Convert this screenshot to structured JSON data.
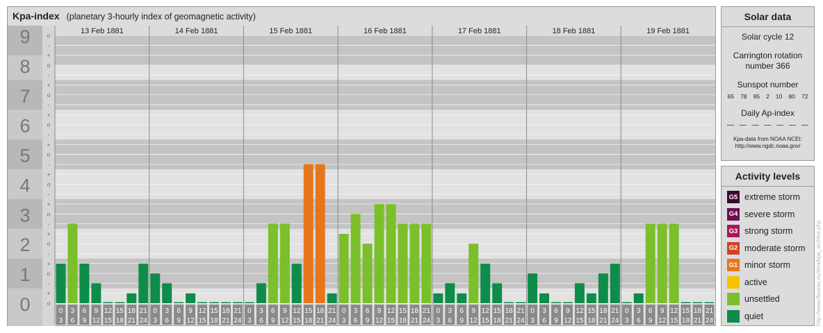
{
  "header": {
    "title": "Kpa-index",
    "subtitle": "(planetary 3-hourly index of geomagnetic activity)"
  },
  "chart_data": {
    "type": "bar",
    "days": [
      "13 Feb 1881",
      "14 Feb 1881",
      "15 Feb 1881",
      "16 Feb 1881",
      "17 Feb 1881",
      "18 Feb 1881",
      "19 Feb 1881"
    ],
    "interval_labels": [
      [
        "0",
        "3"
      ],
      [
        "3",
        "6"
      ],
      [
        "6",
        "9"
      ],
      [
        "9",
        "12"
      ],
      [
        "12",
        "15"
      ],
      [
        "15",
        "18"
      ],
      [
        "18",
        "21"
      ],
      [
        "21",
        "24"
      ]
    ],
    "y_ticks": [
      "0",
      "1",
      "2",
      "3",
      "4",
      "5",
      "6",
      "7",
      "8",
      "9"
    ],
    "sub_ticks": [
      "-",
      "o",
      "+"
    ],
    "ylim": [
      0,
      9.33
    ],
    "values": [
      [
        1.33,
        2.67,
        1.33,
        0.67,
        0,
        0,
        0.33,
        1.33
      ],
      [
        1.0,
        0.67,
        0,
        0.33,
        0,
        0,
        0,
        0
      ],
      [
        0,
        0.67,
        2.67,
        2.67,
        1.33,
        4.67,
        4.67,
        0.33
      ],
      [
        2.33,
        3.0,
        2.0,
        3.33,
        3.33,
        2.67,
        2.67,
        2.67
      ],
      [
        0.33,
        0.67,
        0.33,
        2.0,
        1.33,
        0.67,
        0,
        0
      ],
      [
        1.0,
        0.33,
        0,
        0,
        0.67,
        0.33,
        1.0,
        1.33
      ],
      [
        0,
        0.33,
        2.67,
        2.67,
        2.67,
        0,
        0,
        0
      ]
    ],
    "level_colors": {
      "quiet": "#0e8c4a",
      "unsettled": "#7bbf2a",
      "active": "#f6c200",
      "G1": "#e5771a",
      "G2": "#d34223",
      "G3": "#a8175a",
      "G4": "#6b0f4e",
      "G5": "#3d0730"
    },
    "grid": true
  },
  "solar": {
    "title": "Solar data",
    "cycle": "Solar cycle 12",
    "rotation_line1": "Carrington rotation",
    "rotation_line2": "number 366",
    "sunspot_label": "Sunspot number",
    "sunspots": [
      "65",
      "78",
      "95",
      "2",
      "10",
      "80",
      "72"
    ],
    "ap_label": "Daily Ap-index",
    "ap_values": [
      "—",
      "—",
      "—",
      "—",
      "—",
      "—",
      "—"
    ],
    "credit_line1": "Kpa-data from NOAA NCEI:",
    "credit_line2": "http://www.ngdc.noaa.gov/"
  },
  "activity": {
    "title": "Activity levels",
    "levels": [
      {
        "badge": "G5",
        "label": "extreme storm",
        "color": "#3d0730"
      },
      {
        "badge": "G4",
        "label": "severe storm",
        "color": "#6b0f4e"
      },
      {
        "badge": "G3",
        "label": "strong storm",
        "color": "#a8175a"
      },
      {
        "badge": "G2",
        "label": "moderate storm",
        "color": "#d34223"
      },
      {
        "badge": "G1",
        "label": "minor storm",
        "color": "#e5771a"
      },
      {
        "badge": "",
        "label": "active",
        "color": "#f6c200"
      },
      {
        "badge": "",
        "label": "unsettled",
        "color": "#7bbf2a"
      },
      {
        "badge": "",
        "label": "quiet",
        "color": "#0e8c4a"
      }
    ]
  },
  "watermark": "http://www.fleuvas.eu/tera/kpa_archive.php"
}
